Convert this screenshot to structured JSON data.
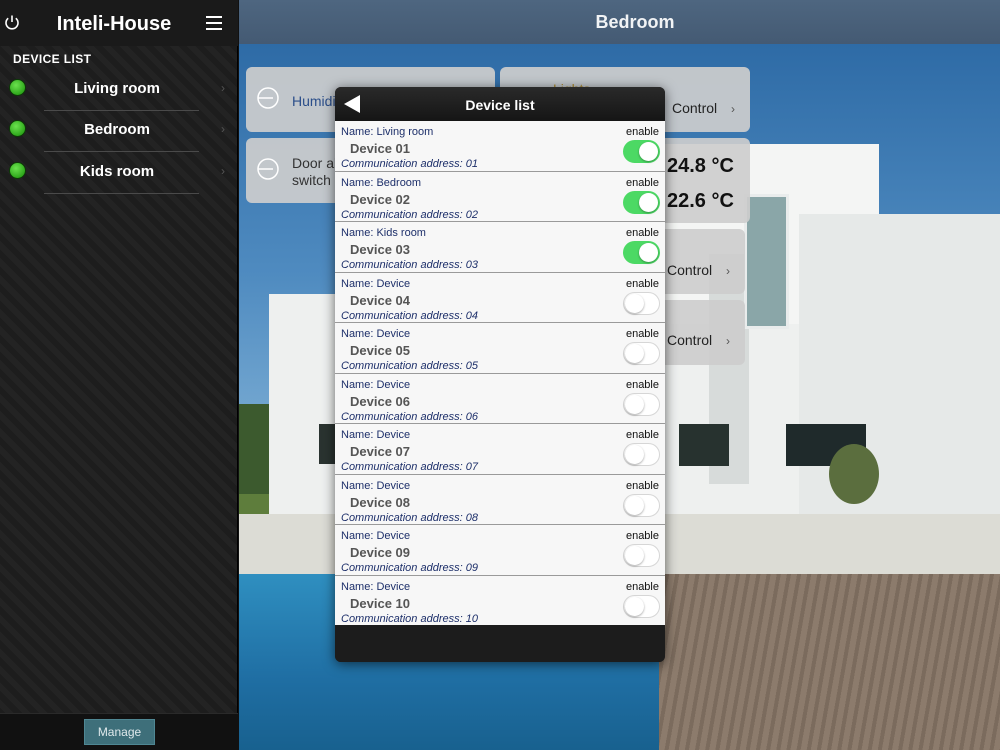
{
  "app": {
    "title": "Inteli-House"
  },
  "sidebar": {
    "section_label": "DEVICE LIST",
    "items": [
      {
        "label": "Living room",
        "status_color": "#3cc02a"
      },
      {
        "label": "Bedroom",
        "status_color": "#3cc02a"
      },
      {
        "label": "Kids room",
        "status_color": "#3cc02a"
      }
    ],
    "manage_label": "Manage"
  },
  "main": {
    "room_title": "Bedroom",
    "tiles": {
      "humidity_label": "Humidi",
      "lights_label": "Lights",
      "door_label": "Door al",
      "door_label2": "switch",
      "control_label": "Control",
      "temp1": "24.8 °C",
      "temp2": "22.6 °C"
    }
  },
  "modal": {
    "title": "Device list",
    "rows": [
      {
        "name": "Name: Living room",
        "device": "Device 01",
        "address": "Communication address: 01",
        "enable_label": "enable",
        "enabled": true
      },
      {
        "name": "Name: Bedroom",
        "device": "Device 02",
        "address": "Communication address: 02",
        "enable_label": "enable",
        "enabled": true
      },
      {
        "name": "Name: Kids room",
        "device": "Device 03",
        "address": "Communication address: 03",
        "enable_label": "enable",
        "enabled": true
      },
      {
        "name": "Name: Device",
        "device": "Device 04",
        "address": "Communication address: 04",
        "enable_label": "enable",
        "enabled": false
      },
      {
        "name": "Name: Device",
        "device": "Device 05",
        "address": "Communication address: 05",
        "enable_label": "enable",
        "enabled": false
      },
      {
        "name": "Name: Device",
        "device": "Device 06",
        "address": "Communication address: 06",
        "enable_label": "enable",
        "enabled": false
      },
      {
        "name": "Name: Device",
        "device": "Device 07",
        "address": "Communication address: 07",
        "enable_label": "enable",
        "enabled": false
      },
      {
        "name": "Name: Device",
        "device": "Device 08",
        "address": "Communication address: 08",
        "enable_label": "enable",
        "enabled": false
      },
      {
        "name": "Name: Device",
        "device": "Device 09",
        "address": "Communication address: 09",
        "enable_label": "enable",
        "enabled": false
      },
      {
        "name": "Name: Device",
        "device": "Device 10",
        "address": "Communication address: 10",
        "enable_label": "enable",
        "enabled": false
      }
    ]
  },
  "colors": {
    "toggle_on": "#4cd964",
    "header_blue": "#4e6680",
    "manage_button": "#3e6f7a"
  },
  "icons": {
    "power": "power-icon",
    "menu": "hamburger-menu-icon",
    "back": "back-arrow-icon",
    "chevron": "chevron-right-icon"
  }
}
